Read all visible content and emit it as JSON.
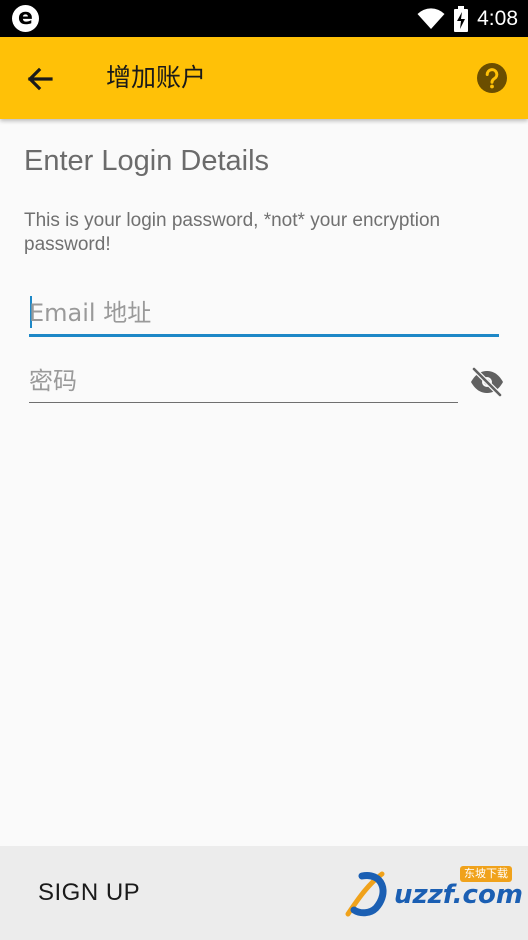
{
  "status_bar": {
    "time": "4:08",
    "app_icon_letter": "e",
    "icons": [
      "wifi-icon",
      "battery-charging-icon"
    ]
  },
  "app_bar": {
    "title": "增加账户",
    "back_icon": "arrow-left-icon",
    "help_icon": "help-circle-icon",
    "color": "#ffc107"
  },
  "form": {
    "heading": "Enter Login Details",
    "subtext": "This is your login password, *not* your encryption password!",
    "email_placeholder": "Email 地址",
    "password_placeholder": "密码",
    "password_toggle_icon": "eye-off-icon",
    "accent_color": "#1e88c7"
  },
  "bottom_bar": {
    "signup_label": "SIGN UP"
  },
  "watermark": {
    "text": "uzzf.com",
    "badge": "东坡下载"
  }
}
